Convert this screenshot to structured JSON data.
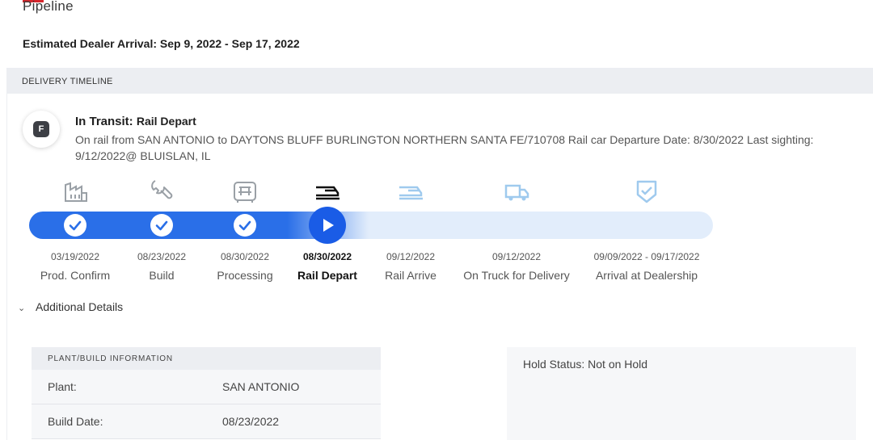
{
  "header": {
    "title": "Pipeline",
    "estimated_arrival": "Estimated Dealer Arrival: Sep 9, 2022 - Sep 17, 2022"
  },
  "timeline": {
    "section_title": "DELIVERY TIMELINE",
    "status_badge_letter": "F",
    "status_title": "In Transit:",
    "status_subtitle": "Rail Depart",
    "status_description": "On rail from SAN ANTONIO to DAYTONS BLUFF BURLINGTON NORTHERN SANTA FE/710708 Rail car Departure Date: 8/30/2022 Last sighting: 9/12/2022@ BLUISLAN, IL",
    "stages": [
      {
        "date": "03/19/2022",
        "label": "Prod. Confirm",
        "icon": "factory-icon",
        "state": "complete"
      },
      {
        "date": "08/23/2022",
        "label": "Build",
        "icon": "wrench-icon",
        "state": "complete"
      },
      {
        "date": "08/30/2022",
        "label": "Processing",
        "icon": "vehicle-front-icon",
        "state": "complete"
      },
      {
        "date": "08/30/2022",
        "label": "Rail Depart",
        "icon": "rail-car-icon",
        "state": "current"
      },
      {
        "date": "09/12/2022",
        "label": "Rail Arrive",
        "icon": "rail-car-icon",
        "state": "pending"
      },
      {
        "date": "09/12/2022",
        "label": "On Truck for Delivery",
        "icon": "truck-icon",
        "state": "pending"
      },
      {
        "date": "09/09/2022 - 09/17/2022",
        "label": "Arrival at Dealership",
        "icon": "shield-check-icon",
        "state": "pending"
      }
    ]
  },
  "details": {
    "toggle_label": "Additional Details",
    "plant_card": {
      "header": "PLANT/BUILD INFORMATION",
      "rows": [
        {
          "key": "Plant:",
          "value": "SAN ANTONIO"
        },
        {
          "key": "Build Date:",
          "value": "08/23/2022"
        }
      ]
    },
    "hold_status": "Hold Status: Not on Hold"
  },
  "colors": {
    "progress_blue": "#2a6fe8",
    "current_blue": "#1a5ce6",
    "pending_icon": "#9fcaee",
    "complete_icon": "#9aa0a6",
    "track_bg": "#e2edfb",
    "brand_red": "#d6262c"
  }
}
